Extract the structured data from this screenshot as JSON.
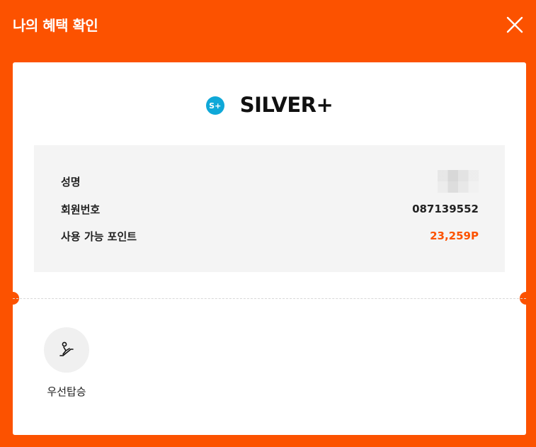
{
  "header": {
    "title": "나의 혜택 확인",
    "close_icon": "close-icon"
  },
  "grade": {
    "badge_text": "S+",
    "name": "SILVER+",
    "badge_color": "#0fa8d8"
  },
  "info": {
    "name_label": "성명",
    "member_no_label": "회원번호",
    "member_no_value": "087139552",
    "points_label": "사용 가능 포인트",
    "points_value": "23,259P"
  },
  "benefits": [
    {
      "label": "우선탑승",
      "icon": "priority-boarding-icon"
    }
  ],
  "colors": {
    "accent": "#fc5200",
    "card": "#ffffff",
    "info_bg": "#f4f4f4"
  }
}
